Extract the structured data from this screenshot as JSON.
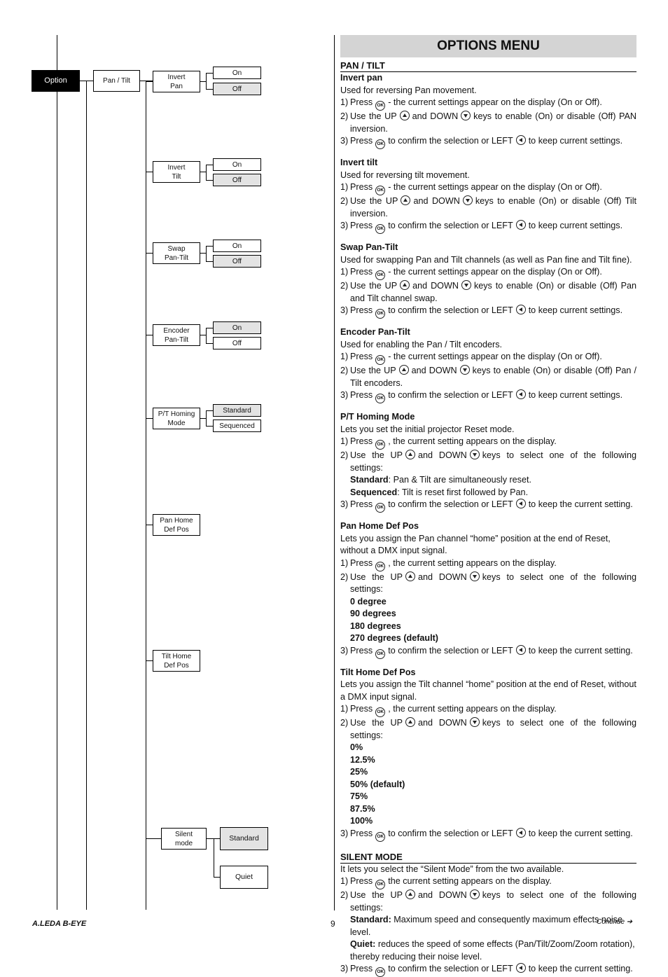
{
  "diagram": {
    "root": "Option",
    "level1": "Pan / Tilt",
    "items": [
      {
        "label": "Invert\nPan",
        "options": [
          {
            "label": "On",
            "selected": false
          },
          {
            "label": "Off",
            "selected": true
          }
        ]
      },
      {
        "label": "Invert\nTilt",
        "options": [
          {
            "label": "On",
            "selected": false
          },
          {
            "label": "Off",
            "selected": true
          }
        ]
      },
      {
        "label": "Swap\nPan-Tilt",
        "options": [
          {
            "label": "On",
            "selected": false
          },
          {
            "label": "Off",
            "selected": true
          }
        ]
      },
      {
        "label": "Encoder\nPan-Tilt",
        "options": [
          {
            "label": "On",
            "selected": true
          },
          {
            "label": "Off",
            "selected": false
          }
        ]
      },
      {
        "label": "P/T Homing\nMode",
        "options": [
          {
            "label": "Standard",
            "selected": true
          },
          {
            "label": "Sequenced",
            "selected": false
          }
        ]
      },
      {
        "label": "Pan Home\nDef Pos",
        "options": []
      },
      {
        "label": "Tilt Home\nDef Pos",
        "options": []
      },
      {
        "label": "Silent\nmode",
        "options": [
          {
            "label": "Standard",
            "selected": true
          },
          {
            "label": "Quiet",
            "selected": false
          }
        ]
      }
    ]
  },
  "doc": {
    "title": "OPTIONS MENU",
    "section1": "PAN / TILT",
    "invert_pan": {
      "heading": "Invert pan",
      "intro": "Used for reversing Pan movement.",
      "s1a": "Press",
      "s1b": "- the current settings appear on the display (On or Off).",
      "s2a": "Use the UP",
      "s2b": "and DOWN",
      "s2c": "keys to enable (On) or disable (Off) PAN inversion.",
      "s3a": "Press",
      "s3b": "to confirm the selection or LEFT",
      "s3c": "to keep current settings."
    },
    "invert_tilt": {
      "heading": "Invert tilt",
      "intro": "Used for reversing tilt movement.",
      "s1a": "Press",
      "s1b": "- the current settings appear on the display (On or Off).",
      "s2a": "Use the UP",
      "s2b": "and DOWN",
      "s2c": "keys to enable (On) or disable (Off) Tilt inversion.",
      "s3a": "Press",
      "s3b": "to confirm the selection or LEFT",
      "s3c": "to keep current settings."
    },
    "swap": {
      "heading": "Swap Pan-Tilt",
      "intro": "Used for swapping Pan and Tilt channels (as well as Pan fine and Tilt fine).",
      "s1a": "Press",
      "s1b": "- the current settings appear on the display (On or Off).",
      "s2a": "Use the UP",
      "s2b": "and DOWN",
      "s2c": "keys to enable (On) or disable (Off) Pan and Tilt channel swap.",
      "s3a": "Press",
      "s3b": "to confirm the selection or LEFT",
      "s3c": "to keep current settings."
    },
    "encoder": {
      "heading": "Encoder Pan-Tilt",
      "intro": "Used for enabling the Pan / Tilt encoders.",
      "s1a": "Press",
      "s1b": "- the current settings appear on the display (On or Off).",
      "s2a": "Use the UP",
      "s2b": "and DOWN",
      "s2c": "keys to enable (On) or disable (Off) Pan / Tilt encoders.",
      "s3a": "Press",
      "s3b": "to confirm the selection or LEFT",
      "s3c": "to keep current settings."
    },
    "homing": {
      "heading": "P/T Homing Mode",
      "intro": "Lets you set the initial projector Reset mode.",
      "s1a": "Press",
      "s1b": ", the current setting appears on the display.",
      "s2a": "Use the UP",
      "s2b": "and DOWN",
      "s2c": "keys to select one of the following settings:",
      "opt1": "Standard",
      "opt1d": ": Pan & Tilt are simultaneously reset.",
      "opt2": "Sequenced",
      "opt2d": ": Tilt is reset first followed by Pan.",
      "s3a": "Press",
      "s3b": "to confirm the selection or LEFT",
      "s3c": "to keep the current setting."
    },
    "panhome": {
      "heading": "Pan Home Def Pos",
      "intro": "Lets you assign the Pan channel “home” position at the end of Reset, without a DMX input signal.",
      "s1a": "Press",
      "s1b": ", the current setting appears on the display.",
      "s2a": "Use the UP",
      "s2b": "and DOWN",
      "s2c": "keys to select one of the following settings:",
      "options": [
        "0 degree",
        "90 degrees",
        "180 degrees",
        "270 degrees (default)"
      ],
      "s3a": "Press",
      "s3b": "to confirm the selection or LEFT",
      "s3c": "to keep the current setting."
    },
    "tilthome": {
      "heading": "Tilt Home Def Pos",
      "intro": "Lets you assign the Tilt channel “home” position at the end of Reset, without a DMX input signal.",
      "s1a": "Press",
      "s1b": ", the current setting appears on the display.",
      "s2a": "Use the UP",
      "s2b": "and DOWN",
      "s2c": "keys to select one of the following settings:",
      "options": [
        "0%",
        "12.5%",
        "25%",
        "50% (default)",
        "75%",
        "87.5%",
        "100%"
      ],
      "s3a": "Press",
      "s3b": "to confirm the selection or LEFT",
      "s3c": "to keep the current setting."
    },
    "section2": "SILENT MODE",
    "silent": {
      "intro": "It lets you select the “Silent Mode” from the two available.",
      "s1a": "Press",
      "s1b": "the current setting appears on the display.",
      "s2a": "Use the UP",
      "s2b": "and DOWN",
      "s2c": "keys to select one of the following settings:",
      "opt1": "Standard:",
      "opt1d": " Maximum speed and consequently maximum effects noise level.",
      "opt2": "Quiet:",
      "opt2d": " reduces the speed of some effects (Pan/Tilt/Zoom/Zoom rotation), thereby reducing their noise level.",
      "s3a": "Press",
      "s3b": "to confirm the selection or LEFT",
      "s3c": "to keep the current setting."
    }
  },
  "footer": {
    "brand": "A.LEDA B-EYE",
    "page": "9",
    "continue": "Continue ➔"
  }
}
